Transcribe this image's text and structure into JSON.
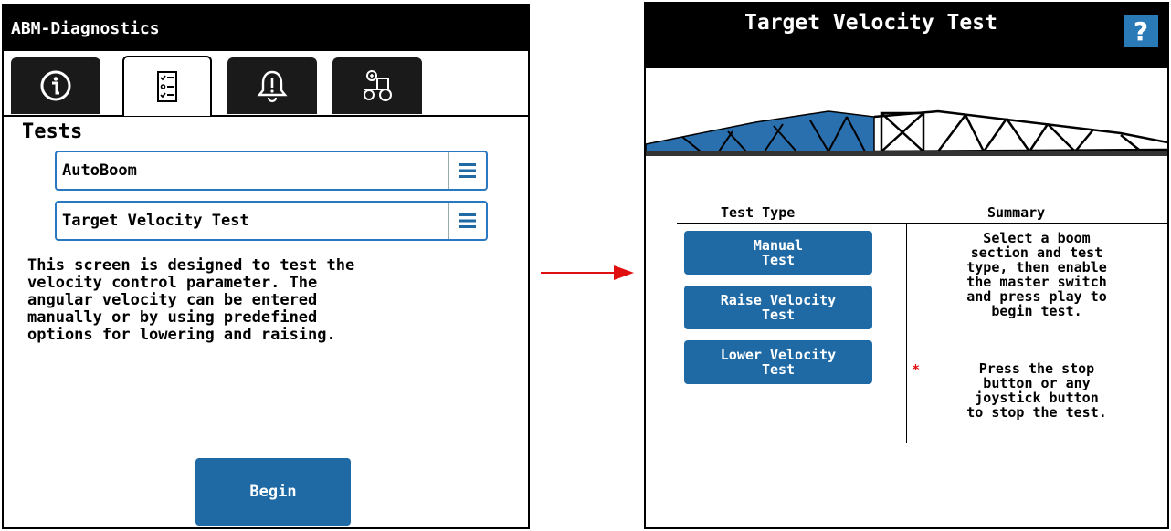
{
  "left": {
    "header_title": "ABM-Diagnostics",
    "tabs": [
      {
        "icon": "info-icon",
        "active": false
      },
      {
        "icon": "checklist-icon",
        "active": true
      },
      {
        "icon": "bell-icon",
        "active": false
      },
      {
        "icon": "tractor-icon",
        "active": false
      }
    ],
    "section_title": "Tests",
    "selects": [
      {
        "value": "AutoBoom"
      },
      {
        "value": "Target Velocity Test"
      }
    ],
    "description": "This screen is designed to test the\nvelocity control parameter. The\nangular velocity can be entered\nmanually or by using predefined\noptions for lowering and raising.",
    "begin_label": "Begin"
  },
  "right": {
    "header_title": "Target Velocity Test",
    "help_label": "?",
    "col_test_type": "Test Type",
    "col_summary": "Summary",
    "buttons": [
      {
        "label": "Manual\nTest"
      },
      {
        "label": "Raise Velocity\nTest"
      },
      {
        "label": "Lower Velocity\nTest"
      }
    ],
    "summary": "Select a boom\nsection and test\ntype, then enable\nthe master switch\nand press play to\nbegin test.",
    "asterisk": "*",
    "note": "Press the stop\nbutton or any\njoystick button\nto stop the test."
  },
  "colors": {
    "accent_blue": "#1f6aa5",
    "arrow_red": "#e01010",
    "header_black": "#000000"
  }
}
